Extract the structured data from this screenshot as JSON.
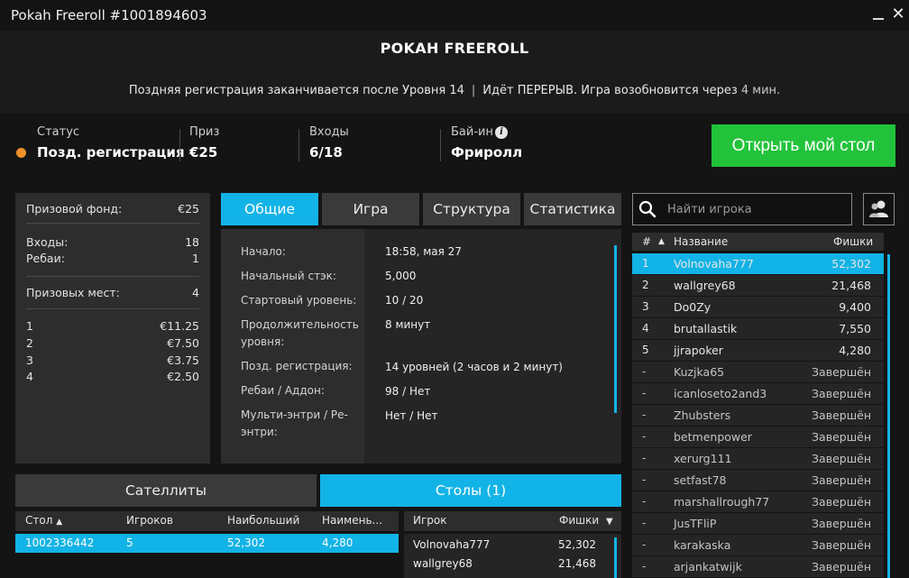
{
  "window": {
    "title": "Pokah Freeroll #1001894603",
    "close_glyph": "✕"
  },
  "header": {
    "name": "POKAH FREEROLL",
    "notice_part1": "Поздняя регистрация заканчивается после Уровня 14",
    "notice_sep": "|",
    "notice_part2": "Идёт ПЕРЕРЫВ. Игра возобновится через",
    "notice_time": "4 мин."
  },
  "info": {
    "status_label": "Статус",
    "status_value": "Позд. регистрация",
    "prize_label": "Приз",
    "prize_value": "€25",
    "entries_label": "Входы",
    "entries_value": "6/18",
    "buyin_label": "Бай-ин",
    "buyin_value": "Фриролл",
    "info_glyph": "i",
    "open_table_button": "Открыть мой стол",
    "status_color": "#f0902a"
  },
  "prize_panel": {
    "pool_label": "Призовой фонд:",
    "pool_value": "€25",
    "entries_label": "Входы:",
    "entries_value": "18",
    "rebuys_label": "Ребаи:",
    "rebuys_value": "1",
    "places_label": "Призовых мест:",
    "places_value": "4",
    "places": [
      {
        "place": "1",
        "amount": "€11.25"
      },
      {
        "place": "2",
        "amount": "€7.50"
      },
      {
        "place": "3",
        "amount": "€3.75"
      },
      {
        "place": "4",
        "amount": "€2.50"
      }
    ]
  },
  "tabs": [
    {
      "label": "Общие",
      "active": true
    },
    {
      "label": "Игра"
    },
    {
      "label": "Структура"
    },
    {
      "label": "Статистика"
    }
  ],
  "general": [
    {
      "label": "Начало:",
      "value": "18:58, мая 27"
    },
    {
      "label": "Начальный стэк:",
      "value": "5,000"
    },
    {
      "label": "Стартовый уровень:",
      "value": "10 / 20"
    },
    {
      "label": "Продолжительность уровня:",
      "value": "8 минут"
    },
    {
      "label": "Позд. регистрация:",
      "value": "14 уровней (2 часов и 2 минут)"
    },
    {
      "label": "Ребаи / Аддон:",
      "value": "98 / Нет"
    },
    {
      "label": "Мульти-энтри / Ре-энтри:",
      "value": "Нет / Нет"
    }
  ],
  "bottom_tabs": {
    "satellites": "Сателлиты",
    "tables": "Столы (1)"
  },
  "tables": {
    "headers": {
      "table": "Стол",
      "sort_glyph": "▲",
      "players": "Игроков",
      "largest": "Наибольший",
      "smallest": "Наимень..."
    },
    "rows": [
      {
        "table": "1002336442",
        "players": "5",
        "largest": "52,302",
        "smallest": "4,280"
      }
    ]
  },
  "table_players": {
    "headers": {
      "player": "Игрок",
      "chips": "Фишки",
      "sort_glyph": "▼"
    },
    "rows": [
      {
        "name": "Volnovaha777",
        "chips": "52,302"
      },
      {
        "name": "wallgrey68",
        "chips": "21,468"
      }
    ]
  },
  "search": {
    "placeholder": "Найти игрока"
  },
  "ranking": {
    "headers": {
      "rank": "#",
      "sort_glyph": "▲",
      "name": "Название",
      "chips": "Фишки"
    },
    "rows": [
      {
        "rank": "1",
        "name": "Volnovaha777",
        "chips": "52,302",
        "selected": true
      },
      {
        "rank": "2",
        "name": "wallgrey68",
        "chips": "21,468"
      },
      {
        "rank": "3",
        "name": "Do0Zy",
        "chips": "9,400"
      },
      {
        "rank": "4",
        "name": "brutallastik",
        "chips": "7,550"
      },
      {
        "rank": "5",
        "name": "jjrapoker",
        "chips": "4,280"
      },
      {
        "rank": "-",
        "name": "Kuzjka65",
        "chips": "Завершён"
      },
      {
        "rank": "-",
        "name": "icanloseto2and3",
        "chips": "Завершён"
      },
      {
        "rank": "-",
        "name": "Zhubsters",
        "chips": "Завершён"
      },
      {
        "rank": "-",
        "name": "betmenpower",
        "chips": "Завершён"
      },
      {
        "rank": "-",
        "name": "xerurg111",
        "chips": "Завершён"
      },
      {
        "rank": "-",
        "name": "setfast78",
        "chips": "Завершён"
      },
      {
        "rank": "-",
        "name": "marshallrough77",
        "chips": "Завершён"
      },
      {
        "rank": "-",
        "name": "JusTFliP",
        "chips": "Завершён"
      },
      {
        "rank": "-",
        "name": "karakaska",
        "chips": "Завершён"
      },
      {
        "rank": "-",
        "name": "arjankatwijk",
        "chips": "Завершён"
      }
    ]
  },
  "colors": {
    "accent": "#12b3e6",
    "green_button": "#22c33a",
    "status_orange": "#f0902a"
  }
}
